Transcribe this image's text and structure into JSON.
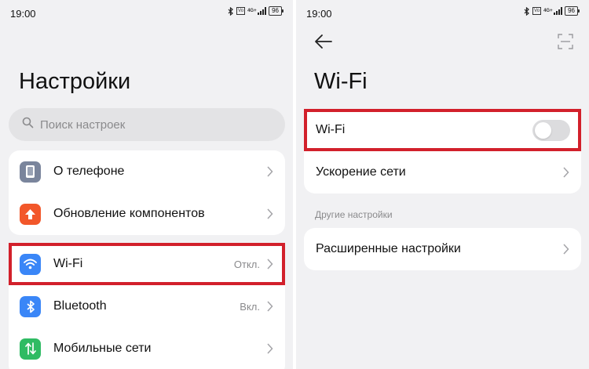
{
  "left": {
    "status": {
      "time": "19:00",
      "sim": "VoLTE",
      "network": "4G+",
      "battery": "96"
    },
    "title": "Настройки",
    "search": {
      "placeholder": "Поиск настроек"
    },
    "group1": [
      {
        "label": "О телефоне",
        "icon": "phone-icon",
        "color": "#7a859c"
      },
      {
        "label": "Обновление компонентов",
        "icon": "arrow-up-icon",
        "color": "#f2572a"
      }
    ],
    "group2": [
      {
        "label": "Wi-Fi",
        "value": "Откл.",
        "icon": "wifi-icon",
        "color": "#3a86f7"
      },
      {
        "label": "Bluetooth",
        "value": "Вкл.",
        "icon": "bluetooth-icon",
        "color": "#3a86f7"
      },
      {
        "label": "Мобильные сети",
        "icon": "mobile-network-icon",
        "color": "#2fbb63"
      }
    ]
  },
  "right": {
    "status": {
      "time": "19:00",
      "sim": "VoLTE",
      "network": "4G+",
      "battery": "96"
    },
    "title": "Wi-Fi",
    "wifi_toggle": {
      "label": "Wi-Fi",
      "enabled": false
    },
    "network_boost": {
      "label": "Ускорение сети"
    },
    "other_section": "Другие настройки",
    "advanced": {
      "label": "Расширенные настройки"
    }
  },
  "highlight_color": "#d2202b"
}
